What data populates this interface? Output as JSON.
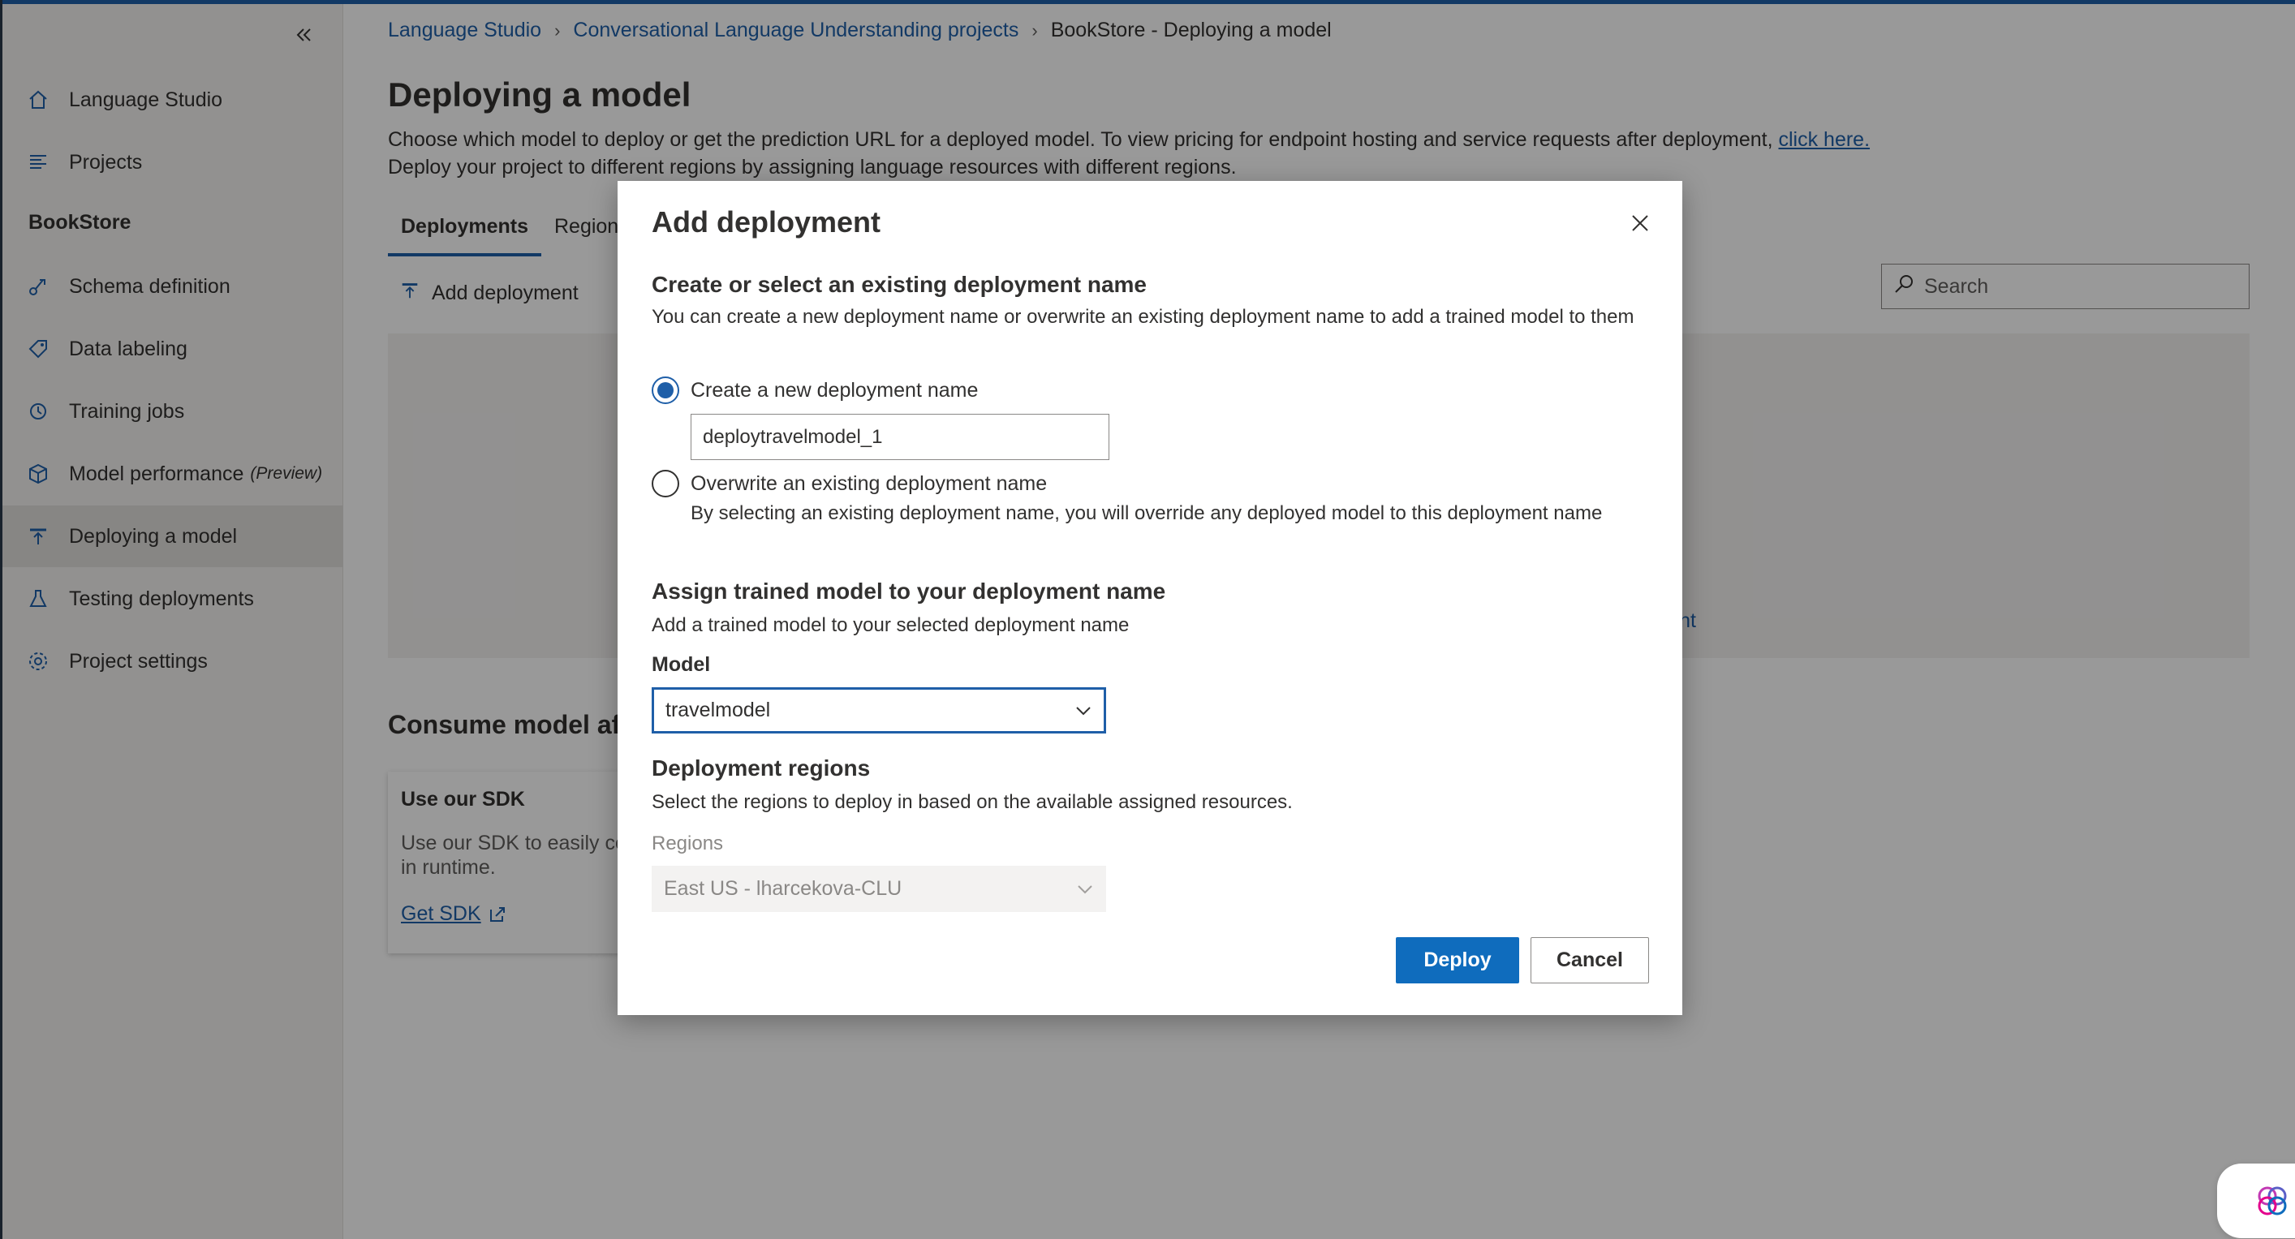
{
  "sidebar": {
    "collapse_icon": "double-chevron-left-icon",
    "items_top": [
      {
        "label": "Language Studio",
        "icon": "home-icon"
      },
      {
        "label": "Projects",
        "icon": "list-icon"
      }
    ],
    "project_name": "BookStore",
    "items_project": [
      {
        "label": "Schema definition",
        "icon": "schema-icon"
      },
      {
        "label": "Data labeling",
        "icon": "tag-icon"
      },
      {
        "label": "Training jobs",
        "icon": "training-icon"
      },
      {
        "label": "Model performance",
        "suffix": "(Preview)",
        "icon": "cube-icon"
      },
      {
        "label": "Deploying a model",
        "icon": "deploy-icon",
        "active": true
      },
      {
        "label": "Testing deployments",
        "icon": "flask-icon"
      },
      {
        "label": "Project settings",
        "icon": "gear-icon"
      }
    ]
  },
  "breadcrumb": {
    "items": [
      "Language Studio",
      "Conversational Language Understanding projects"
    ],
    "current": "BookStore - Deploying a model"
  },
  "page": {
    "title": "Deploying a model",
    "description_line1": "Choose which model to deploy or get the prediction URL for a deployed model. To view pricing for endpoint hosting and service requests after deployment,",
    "description_link": "click here.",
    "description_line2": "Deploy your project to different regions by assigning language resources with different regions.",
    "tabs": [
      "Deployments",
      "Regions"
    ],
    "add_deployment_label": "Add deployment",
    "search_placeholder": "Search",
    "table_link_partial": "oyment",
    "consume_title": "Consume model after deployment",
    "sdk_card": {
      "title": "Use our SDK",
      "text": "Use our SDK to easily consume your model in runtime.",
      "link": "Get SDK"
    }
  },
  "dialog": {
    "title": "Add deployment",
    "section1_heading": "Create or select an existing deployment name",
    "section1_text": "You can create a new deployment name or overwrite an existing deployment name to add a trained model to them",
    "radio_new_label": "Create a new deployment name",
    "new_name_value": "deploytravelmodel_1",
    "radio_overwrite_label": "Overwrite an existing deployment name",
    "overwrite_help": "By selecting an existing deployment name, you will override any deployed model to this deployment name",
    "section2_heading": "Assign trained model to your deployment name",
    "section2_text": "Add a trained model to your selected deployment name",
    "model_label": "Model",
    "model_value": "travelmodel",
    "section3_heading": "Deployment regions",
    "section3_text": "Select the regions to deploy in based on the available assigned resources.",
    "regions_label": "Regions",
    "regions_value": "East US - lharcekova-CLU",
    "deploy_label": "Deploy",
    "cancel_label": "Cancel"
  },
  "colors": {
    "accent": "#0f6cbd",
    "link": "#1f5fa8",
    "sidebar_bg": "#f3f2f1"
  }
}
